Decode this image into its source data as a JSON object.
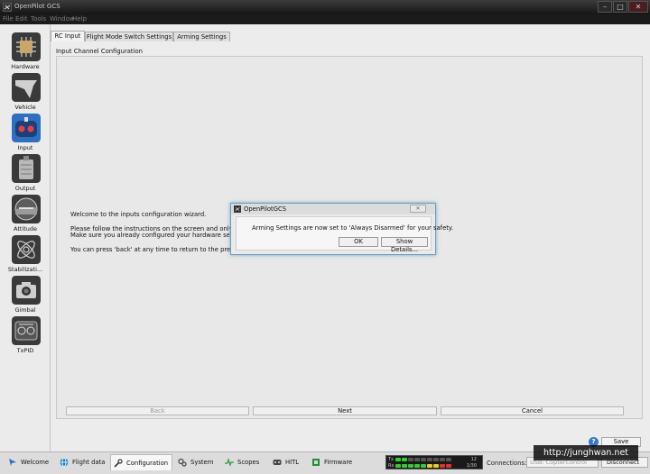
{
  "window": {
    "title": "OpenPilot GCS"
  },
  "menu": [
    "File",
    "Edit",
    "Tools",
    "Window",
    "Help"
  ],
  "sidebar": {
    "items": [
      {
        "label": "Hardware",
        "icon": "chip-icon"
      },
      {
        "label": "Vehicle",
        "icon": "vehicle-icon"
      },
      {
        "label": "Input",
        "icon": "gamepad-icon"
      },
      {
        "label": "Output",
        "icon": "motor-icon"
      },
      {
        "label": "Attitude",
        "icon": "attitude-icon"
      },
      {
        "label": "Stabilizati...",
        "icon": "stabilization-icon"
      },
      {
        "label": "Gimbal",
        "icon": "camera-icon"
      },
      {
        "label": "TxPID",
        "icon": "txpid-icon"
      }
    ]
  },
  "tabs": [
    "RC Input",
    "Flight Mode Switch Settings",
    "Arming Settings"
  ],
  "group_title": "Input Channel Configuration",
  "wizard": {
    "line1": "Welcome to the inputs configuration wizard.",
    "line2": "Please follow the instructions on the screen and only mo",
    "line3": "Make sure you already configured your hardware setting",
    "line4": "You can press 'back' at any time to return to the previou",
    "back": "Back",
    "next": "Next",
    "cancel": "Cancel"
  },
  "save": "Save",
  "help": "?",
  "dialog": {
    "title": "OpenPilotGCS",
    "message": "Arming Settings are now set to 'Always Disarmed' for your safety.",
    "ok": "OK",
    "details": "Show Details..."
  },
  "bottom": {
    "modes": [
      "Welcome",
      "Flight data",
      "Configuration",
      "System",
      "Scopes",
      "HITL",
      "Firmware"
    ],
    "tx": "Tx",
    "rx": "Rx",
    "tx_value": "12",
    "rx_value": "1/30",
    "connections_label": "Connections:",
    "connection_value": "USB: CopterControl",
    "disconnect": "Disconnect"
  },
  "watermark": "http://junghwan.net",
  "colors": {
    "accent_blue": "#2f6fbf",
    "titlebar": "#1f1f1f",
    "dialog_glow": "#3c8cbe"
  }
}
